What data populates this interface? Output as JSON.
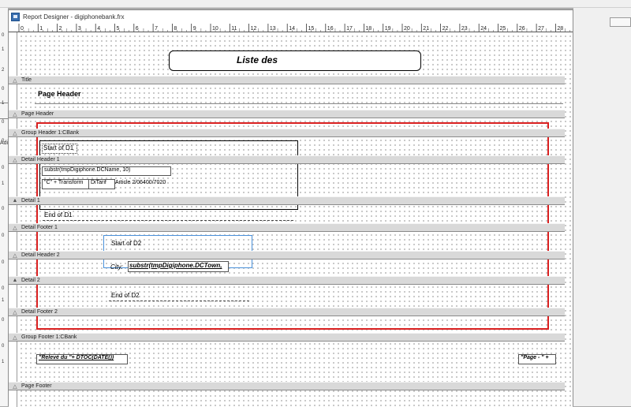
{
  "window": {
    "title": "Report Designer - digiphonebank.frx"
  },
  "ruler": {
    "ticks": [
      "0",
      "1",
      "2",
      "3",
      "4",
      "5",
      "6",
      "7",
      "8",
      "9",
      "10",
      "11",
      "12",
      "13",
      "14",
      "15",
      "16",
      "17",
      "18",
      "19",
      "20",
      "21",
      "22",
      "23",
      "24",
      "25",
      "26",
      "27",
      "28"
    ]
  },
  "bands": {
    "title": "Title",
    "page_header": "Page Header",
    "group_header": "Group Header 1:CBank",
    "detail_header_1": "Detail Header 1",
    "detail_1": "Detail 1",
    "detail_footer_1": "Detail Footer 1",
    "detail_header_2": "Detail Header 2",
    "detail_2": "Detail 2",
    "detail_footer_2": "Detail Footer 2",
    "group_footer": "Group Footer 1:CBank",
    "page_footer": "Page Footer"
  },
  "controls": {
    "report_title": "Liste des",
    "page_header_label": "Page Header",
    "d1_start": "Start of D1",
    "d1_name_field": "substr(tmpDigiphone.DCName, 10)",
    "d1_transform_field": "\"C\" + Transform",
    "d1_tarif_field": "DiTarif",
    "d1_article": "Article 2/06400/7020",
    "d1_end": "End of D1",
    "d2_start": "Start of D2",
    "d2_city_label": "City:",
    "d2_town_field": "substr(tmpDigiphone.DCTown,",
    "d2_end": "End of D2",
    "releve_field": "\"Relevé du \"+ DTOC(DATE())",
    "page_field": "\"Page - \" +"
  },
  "background": {
    "left_fragment": "Adi"
  },
  "colors": {
    "group_rect": "#d92020",
    "detail2_rect": "#4a90d9",
    "band_bg": "#d9d9d9"
  }
}
